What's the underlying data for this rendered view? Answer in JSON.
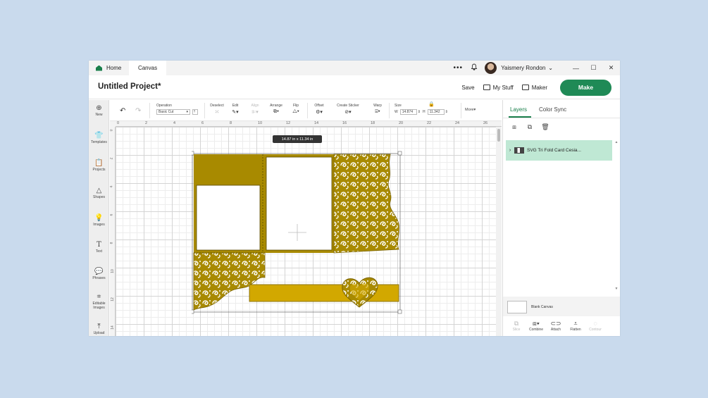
{
  "titlebar": {
    "tabs": [
      {
        "label": "Home"
      },
      {
        "label": "Canvas"
      }
    ],
    "more": "•••",
    "user_name": "Yaismery Rondon",
    "window_controls": [
      "—",
      "☐",
      "✕"
    ]
  },
  "header": {
    "project_title": "Untitled Project*",
    "save_label": "Save",
    "my_stuff_label": "My Stuff",
    "maker_label": "Maker",
    "make_label": "Make"
  },
  "sidebar": {
    "items": [
      {
        "label": "New",
        "icon": "plus-circle-icon"
      },
      {
        "label": "Templates",
        "icon": "shirt-icon"
      },
      {
        "label": "Projects",
        "icon": "clipboard-icon"
      },
      {
        "label": "Shapes",
        "icon": "shapes-icon"
      },
      {
        "label": "Images",
        "icon": "lightbulb-icon"
      },
      {
        "label": "Text",
        "icon": "text-icon"
      },
      {
        "label": "Phrases",
        "icon": "speech-bubble-icon"
      },
      {
        "label": "Editable Images",
        "icon": "editable-image-icon"
      },
      {
        "label": "Upload",
        "icon": "upload-icon"
      }
    ]
  },
  "toolbar": {
    "operation_label": "Operation",
    "operation_value": "Basic Cut",
    "deselect_label": "Deselect",
    "edit_label": "Edit",
    "align_label": "Align",
    "arrange_label": "Arrange",
    "flip_label": "Flip",
    "offset_label": "Offset",
    "create_sticker_label": "Create Sticker",
    "warp_label": "Warp",
    "size_label": "Size",
    "w_label": "W",
    "w_value": "14.874",
    "h_label": "H",
    "h_value": "11.342",
    "more_label": "More"
  },
  "canvas": {
    "ruler_top": [
      "0",
      "2",
      "4",
      "6",
      "8",
      "10",
      "12",
      "14",
      "16",
      "18",
      "20",
      "22",
      "24",
      "26"
    ],
    "ruler_left": [
      "0",
      "2",
      "4",
      "6",
      "8",
      "10",
      "12",
      "14"
    ],
    "size_tag": "14.87  in x 11.34  in",
    "colors": {
      "gold": "#a88a00",
      "gold_bright": "#d2a800",
      "gold_dark": "#7a6300"
    }
  },
  "right_panel": {
    "tabs": [
      {
        "label": "Layers"
      },
      {
        "label": "Color Sync"
      }
    ],
    "tools": [
      "group-icon",
      "duplicate-icon",
      "trash-icon"
    ],
    "layer_name": "SVG Tri Fold Card Cesia...",
    "blank_canvas_label": "Blank Canvas",
    "bottom_actions": [
      {
        "label": "Slice",
        "enabled": false
      },
      {
        "label": "Combine",
        "enabled": true
      },
      {
        "label": "Attach",
        "enabled": true
      },
      {
        "label": "Flatten",
        "enabled": true
      },
      {
        "label": "Contour",
        "enabled": false
      }
    ]
  }
}
